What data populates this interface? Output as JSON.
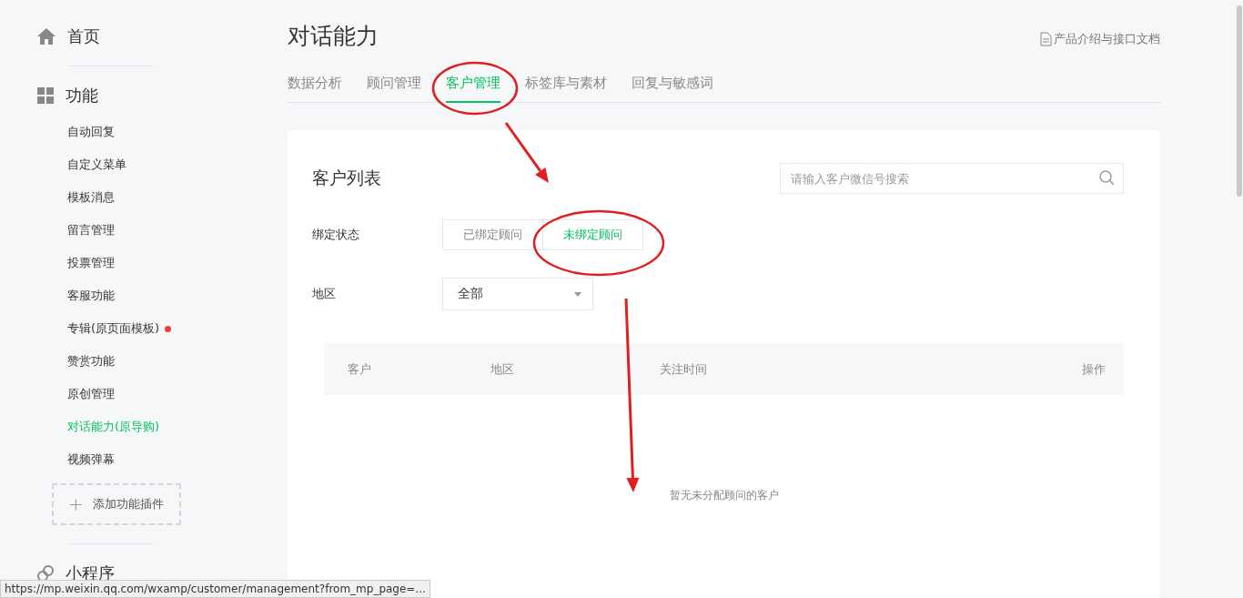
{
  "sidebar": {
    "home": {
      "label": "首页"
    },
    "section": {
      "label": "功能"
    },
    "items": [
      {
        "label": "自动回复",
        "selected": false,
        "badge": false
      },
      {
        "label": "自定义菜单",
        "selected": false,
        "badge": false
      },
      {
        "label": "模板消息",
        "selected": false,
        "badge": false
      },
      {
        "label": "留言管理",
        "selected": false,
        "badge": false
      },
      {
        "label": "投票管理",
        "selected": false,
        "badge": false
      },
      {
        "label": "客服功能",
        "selected": false,
        "badge": false
      },
      {
        "label": "专辑(原页面模板)",
        "selected": false,
        "badge": true
      },
      {
        "label": "赞赏功能",
        "selected": false,
        "badge": false
      },
      {
        "label": "原创管理",
        "selected": false,
        "badge": false
      },
      {
        "label": "对话能力(原导购)",
        "selected": true,
        "badge": false
      },
      {
        "label": "视频弹幕",
        "selected": false,
        "badge": false
      }
    ],
    "add_button": {
      "icon": "+",
      "label": "添加功能插件"
    },
    "next_section": {
      "label": "小程序"
    }
  },
  "page": {
    "title": "对话能力",
    "doc_link": "产品介绍与接口文档"
  },
  "tabs": [
    {
      "label": "数据分析",
      "selected": false
    },
    {
      "label": "顾问管理",
      "selected": false
    },
    {
      "label": "客户管理",
      "selected": true
    },
    {
      "label": "标签库与素材",
      "selected": false
    },
    {
      "label": "回复与敏感词",
      "selected": false
    }
  ],
  "card": {
    "title": "客户列表",
    "search": {
      "placeholder": "请输入客户微信号搜索"
    },
    "bind_filter": {
      "label": "绑定状态",
      "options": [
        {
          "label": "已绑定顾问",
          "selected": false
        },
        {
          "label": "未绑定顾问",
          "selected": true
        }
      ]
    },
    "region_filter": {
      "label": "地区",
      "value": "全部"
    },
    "table": {
      "columns": [
        "客户",
        "地区",
        "关注时间",
        "操作"
      ],
      "empty_text": "暂无未分配顾问的客户"
    }
  },
  "status_bar": {
    "url": "https://mp.weixin.qq.com/wxamp/customer/management?from_mp_page=..."
  },
  "annotations": [
    {
      "kind": "ellipse"
    },
    {
      "kind": "arrow"
    },
    {
      "kind": "ellipse"
    },
    {
      "kind": "arrow"
    }
  ]
}
